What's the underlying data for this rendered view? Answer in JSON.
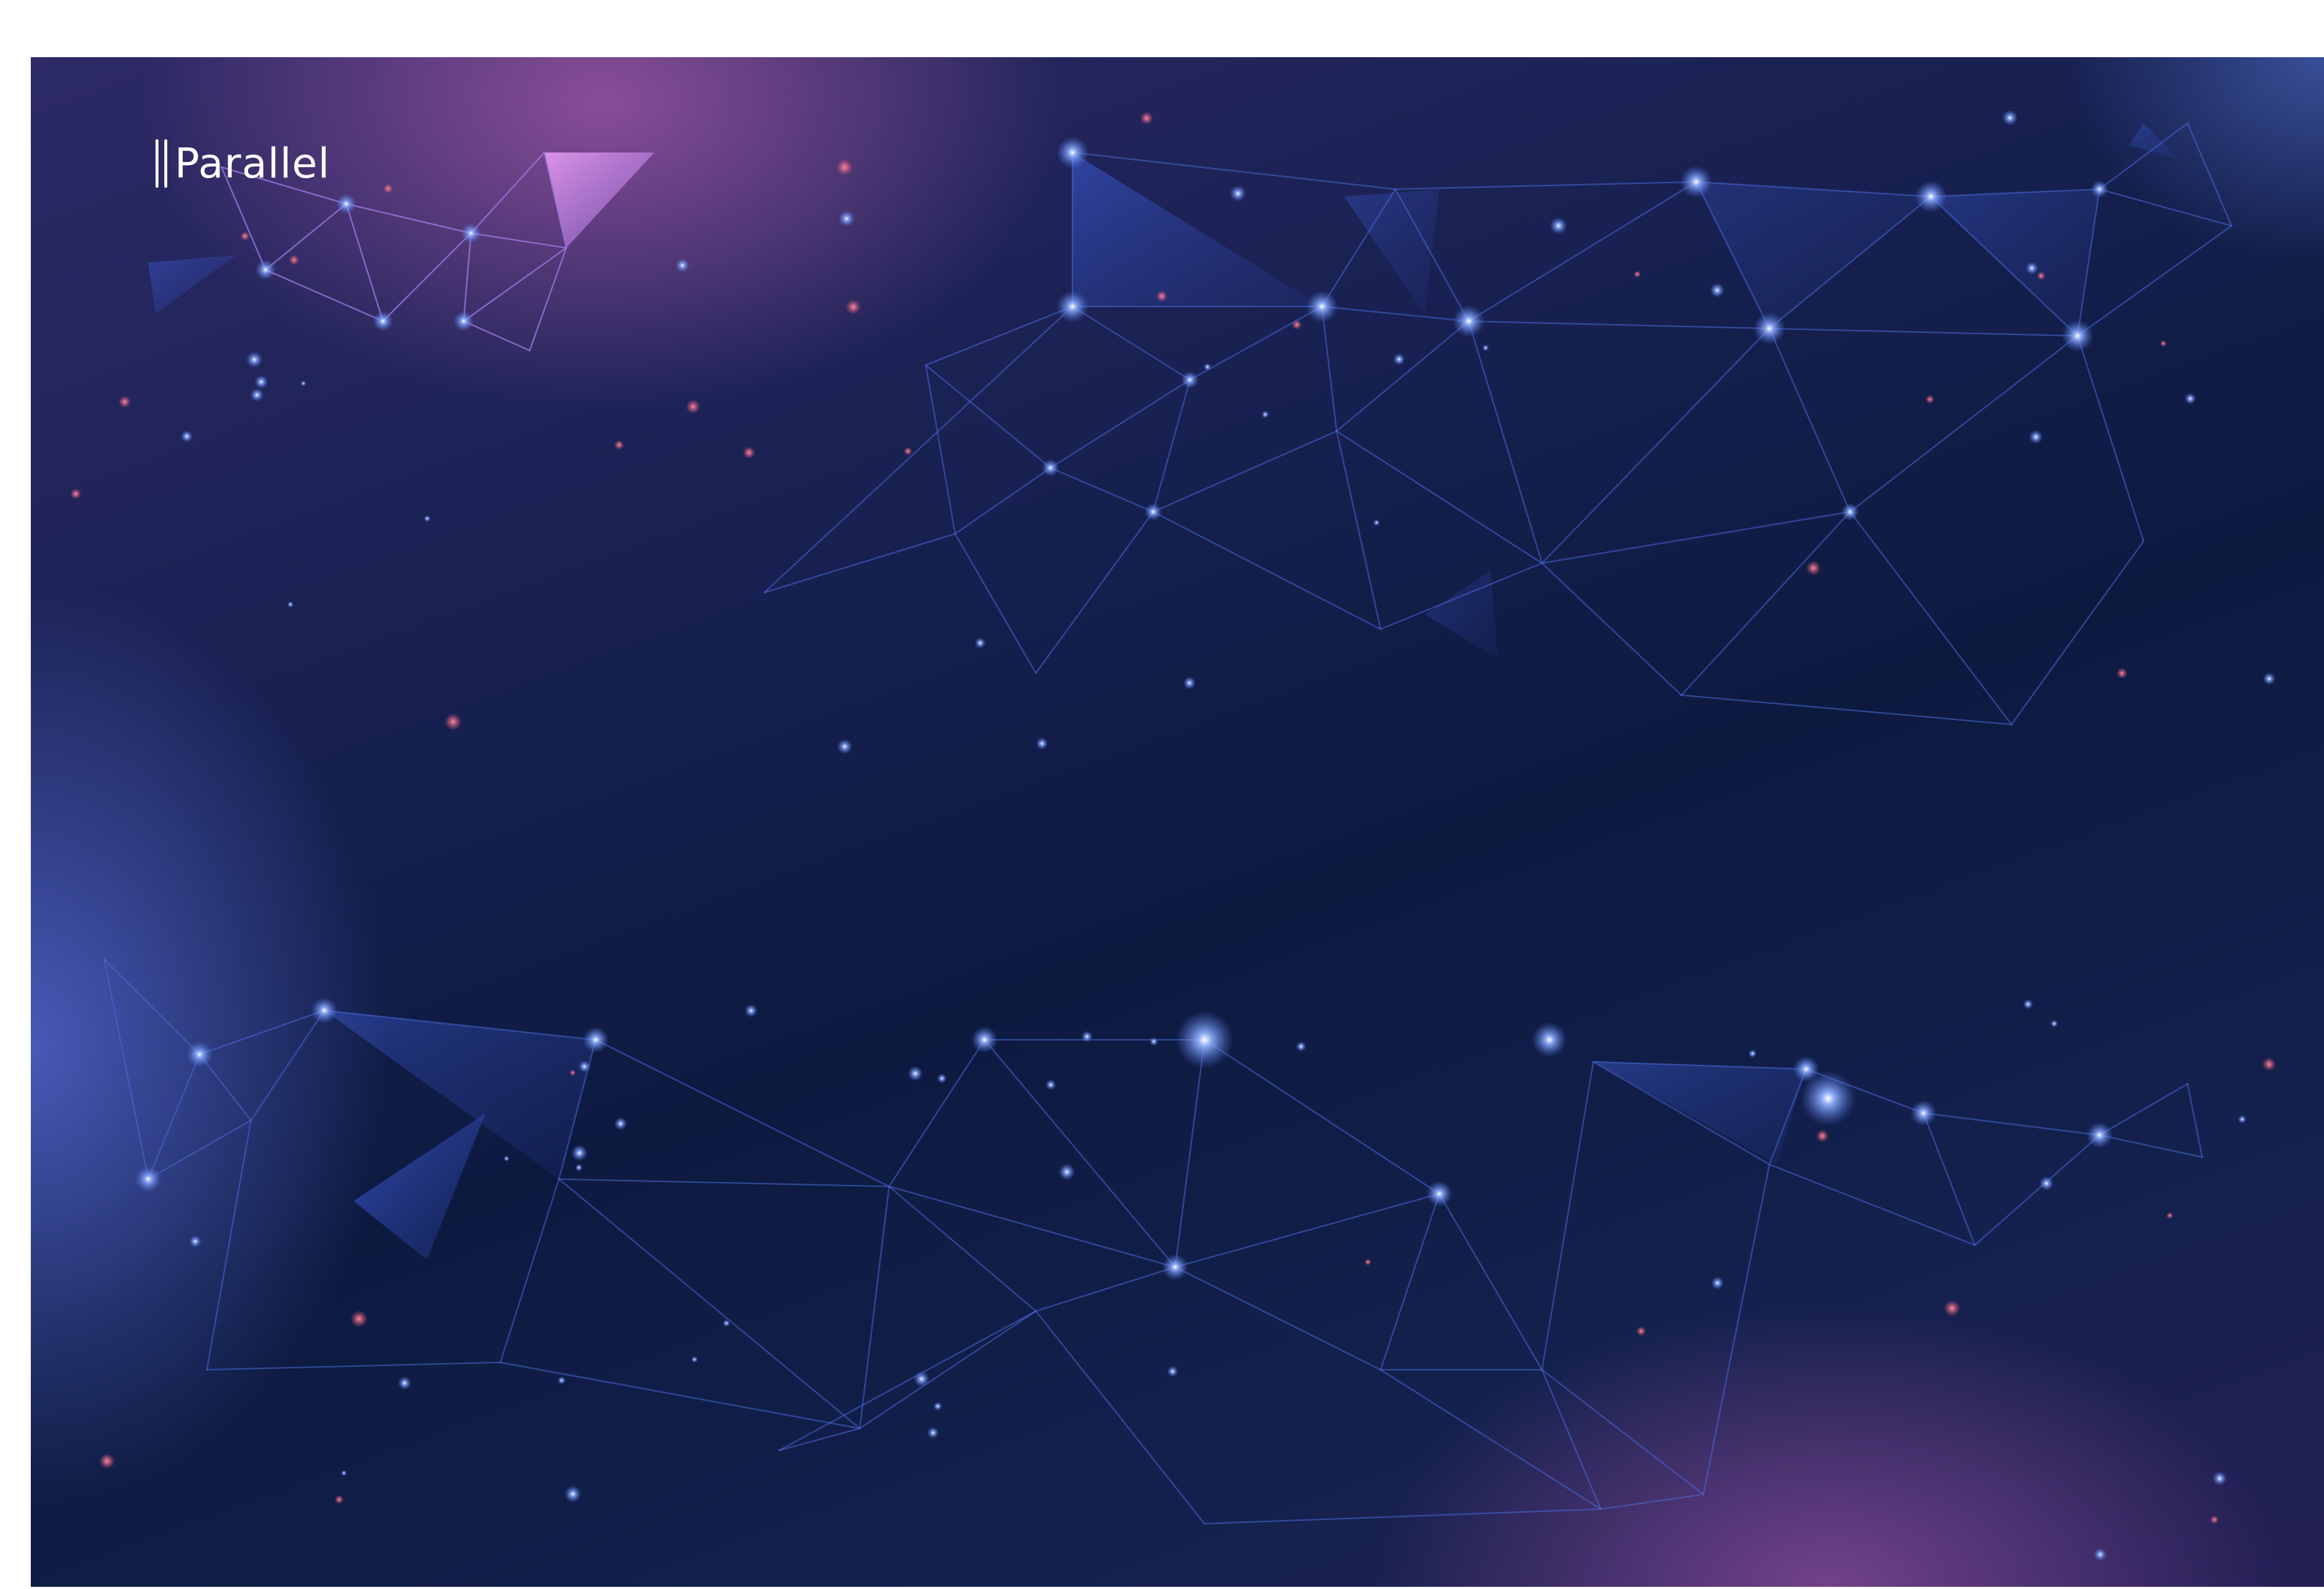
{
  "brand": {
    "name": "Parallel",
    "logo_icon": "double-bar-icon"
  },
  "colors": {
    "background_dark": "#0d1a40",
    "background_mid": "#16204f",
    "glow_purple": "#aa5aaa",
    "glow_blue": "#5a6edc",
    "line_blue": "#4a6ad8",
    "line_purple": "#9a78e0",
    "node_glow": "#8fb0ff",
    "node_red": "#e05070",
    "text": "#ffffff"
  },
  "decoration": {
    "style": "low-poly network mesh",
    "icon": "network-mesh-icon"
  }
}
